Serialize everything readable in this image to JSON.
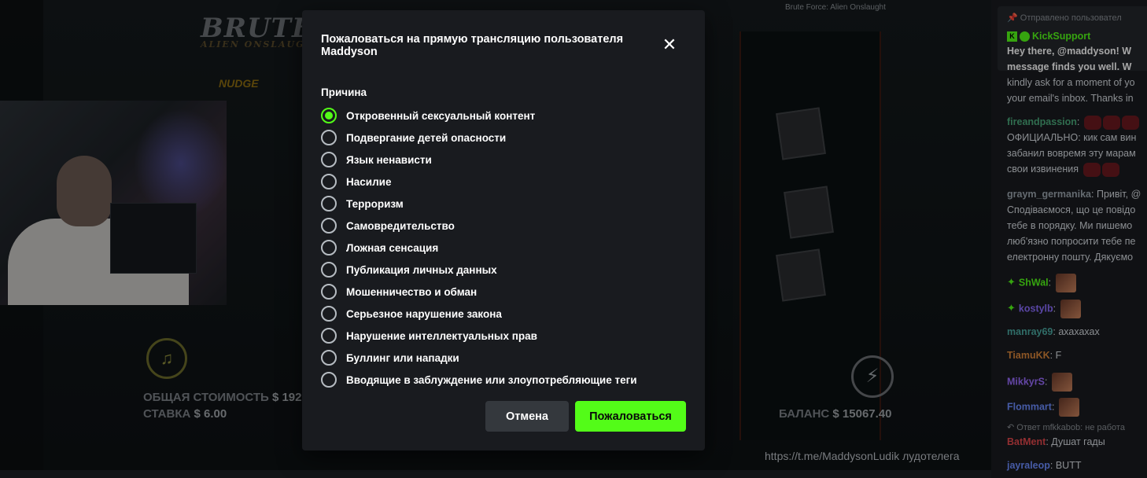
{
  "background": {
    "game_name": "Brute Force: Alien Onslaught",
    "logo_title": "BRUTE FORCE",
    "logo_subtitle": "ALIEN ONSLAUGHT",
    "nudge": "NUDGE",
    "total_cost_label": "ОБЩАЯ СТОИМОСТЬ",
    "total_cost_value": "$ 192",
    "bet_label": "СТАВКА",
    "bet_value": "$ 6.00",
    "balance_label": "БАЛАНС",
    "balance_value": "$ 15067.40",
    "telegram_link": "https://t.me/MaddysonLudik лудотелега",
    "currency": "USD"
  },
  "chat": {
    "pinned_header": "Отправлено пользовател",
    "pinned_user": "KickSupport",
    "pinned_lines": [
      "Hey there, @maddyson! W",
      "message finds you well. W",
      "kindly ask for a moment of yo",
      "your email's inbox. Thanks in"
    ],
    "messages": [
      {
        "user": "fireandpassion",
        "lines": [
          "ОФИЦИАЛЬНО: кик сам вин",
          "забанил вовремя эту марам",
          "свои извинения"
        ]
      },
      {
        "user": "graym_germanika",
        "lines": [
          "Привіт, @",
          "Сподіваємося, що це повідо",
          "тебе в порядку. Ми пишемо",
          "люб'язно попросити тебе пе",
          "електронну пошту. Дякуємо"
        ]
      },
      {
        "user": "ShWal",
        "text": ""
      },
      {
        "user": "kostylb",
        "text": ""
      },
      {
        "user": "manray69",
        "text": "ахахахах"
      },
      {
        "user": "TiamuKK",
        "text": "F"
      },
      {
        "user": "MikkyrS",
        "text": ""
      },
      {
        "user": "Flommart",
        "text": ""
      },
      {
        "reply": "Ответ mfkkabob: не работа"
      },
      {
        "user": "BatMent",
        "text": "Душат гады"
      },
      {
        "user": "jayraleop",
        "text": "BUTT"
      }
    ],
    "colors": {
      "fireandpassion": "#4aa87a",
      "graym_germanika": "#9aa4ad",
      "ShWal": "#53fc18",
      "kostylb": "#8a6cff",
      "manray69": "#4aa8a0",
      "TiamuKK": "#d8843a",
      "MikkyrS": "#9a6cff",
      "Flommart": "#6c8cff",
      "BatMent": "#e0474c",
      "jayraleop": "#6c8cff"
    }
  },
  "modal": {
    "title": "Пожаловаться на прямую трансляцию пользователя Maddyson",
    "close_icon": "close-icon",
    "reason_label": "Причина",
    "selected_index": 0,
    "options": [
      "Откровенный сексуальный контент",
      "Подвергание детей опасности",
      "Язык ненависти",
      "Насилие",
      "Терроризм",
      "Самовредительство",
      "Ложная сенсация",
      "Публикация личных данных",
      "Мошенничество и обман",
      "Серьезное нарушение закона",
      "Нарушение интеллектуальных прав",
      "Буллинг или нападки",
      "Вводящие в заблуждение или злоупотребляющие теги"
    ],
    "cancel_label": "Отмена",
    "report_label": "Пожаловаться",
    "accent_color": "#53fc18"
  }
}
